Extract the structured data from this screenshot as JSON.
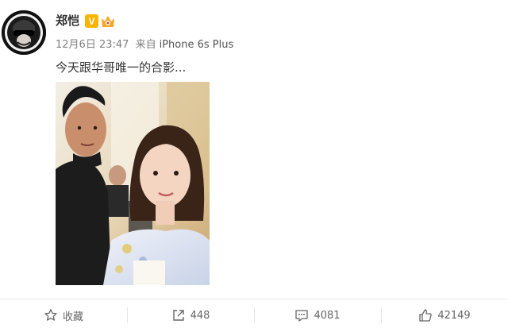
{
  "post": {
    "username": "郑恺",
    "badges": {
      "verified": "V"
    },
    "date": "12月6日 23:47",
    "source_prefix": "来自",
    "device": "iPhone 6s Plus",
    "text": "今天跟华哥唯一的合影..."
  },
  "actions": {
    "favorite_label": "收藏",
    "share_count": "448",
    "comment_count": "4081",
    "like_count": "42149"
  },
  "icons": {
    "favorite": "star-icon",
    "share": "share-icon",
    "comment": "comment-icon",
    "like": "thumbs-up-icon"
  },
  "colors": {
    "verified_badge": "#f7b500",
    "vip_badge": "#f5a623",
    "meta_text": "#808080",
    "divider": "#e6e6e6"
  }
}
